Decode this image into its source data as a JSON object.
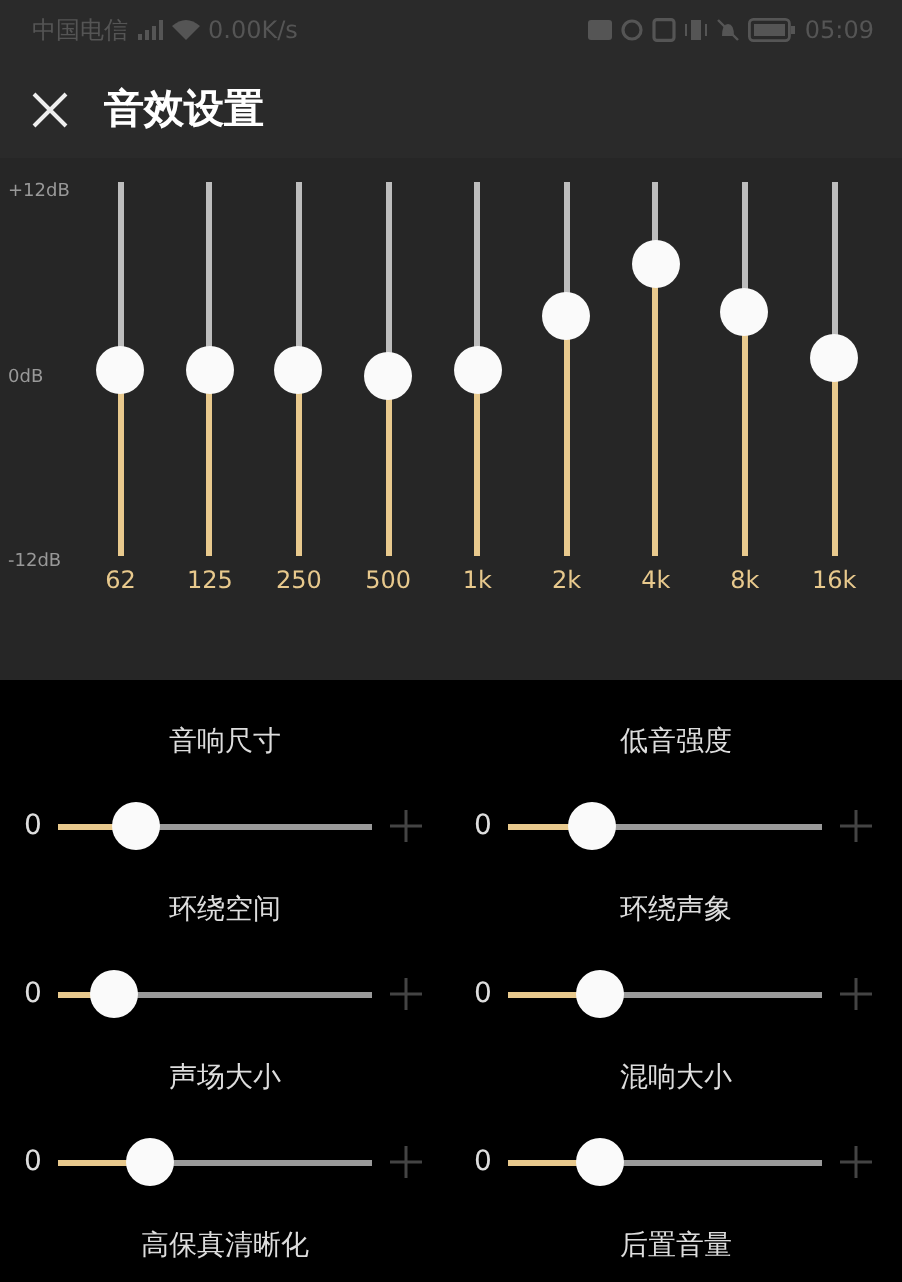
{
  "status_bar": {
    "carrier": "中国电信",
    "speed": "0.00K/s",
    "time": "05:09"
  },
  "header": {
    "title": "音效设置"
  },
  "equalizer": {
    "scale": [
      "+12dB",
      "0dB",
      "-12dB"
    ],
    "bands": [
      {
        "label": "62",
        "level": 0.5
      },
      {
        "label": "125",
        "level": 0.5
      },
      {
        "label": "250",
        "level": 0.5
      },
      {
        "label": "500",
        "level": 0.48
      },
      {
        "label": "1k",
        "level": 0.5
      },
      {
        "label": "2k",
        "level": 0.64
      },
      {
        "label": "4k",
        "level": 0.78
      },
      {
        "label": "8k",
        "level": 0.65
      },
      {
        "label": "16k",
        "level": 0.53
      }
    ]
  },
  "effects": [
    {
      "label": "音响尺寸",
      "value": "0",
      "level": 0.25
    },
    {
      "label": "低音强度",
      "value": "0",
      "level": 0.27
    },
    {
      "label": "环绕空间",
      "value": "0",
      "level": 0.18
    },
    {
      "label": "环绕声象",
      "value": "0",
      "level": 0.29
    },
    {
      "label": "声场大小",
      "value": "0",
      "level": 0.29
    },
    {
      "label": "混响大小",
      "value": "0",
      "level": 0.29
    },
    {
      "label": "高保真清晰化"
    },
    {
      "label": "后置音量"
    }
  ]
}
